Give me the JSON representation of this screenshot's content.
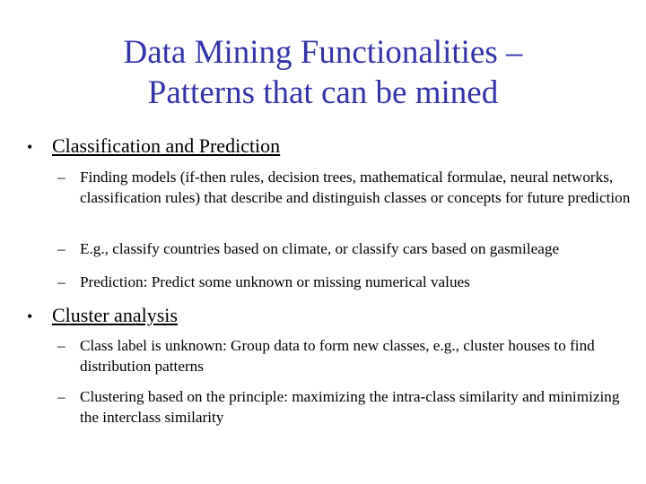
{
  "slide": {
    "title_lines": [
      "Data Mining Functionalities –",
      "Patterns that can be mined"
    ],
    "title_color": "#3333aa",
    "bullets": [
      {
        "marker": "•",
        "label": "Classification and Prediction",
        "subitems": [
          {
            "marker": "–",
            "text": "Finding models (if-then rules, decision trees, mathematical formulae, neural networks, classification rules) that describe and distinguish classes or concepts for future prediction"
          },
          {
            "marker": "–",
            "text": "E.g., classify countries based on climate, or classify cars based on gasmileage"
          },
          {
            "marker": "–",
            "text": "Prediction: Predict some unknown or missing numerical values"
          }
        ]
      },
      {
        "marker": "•",
        "label": "Cluster analysis",
        "subitems": [
          {
            "marker": "–",
            "text": "Class label is unknown: Group data to form new classes, e.g., cluster houses to find distribution patterns"
          },
          {
            "marker": "–",
            "text": "Clustering based on the principle: maximizing the intra-class similarity and minimizing the interclass similarity"
          }
        ]
      }
    ]
  }
}
